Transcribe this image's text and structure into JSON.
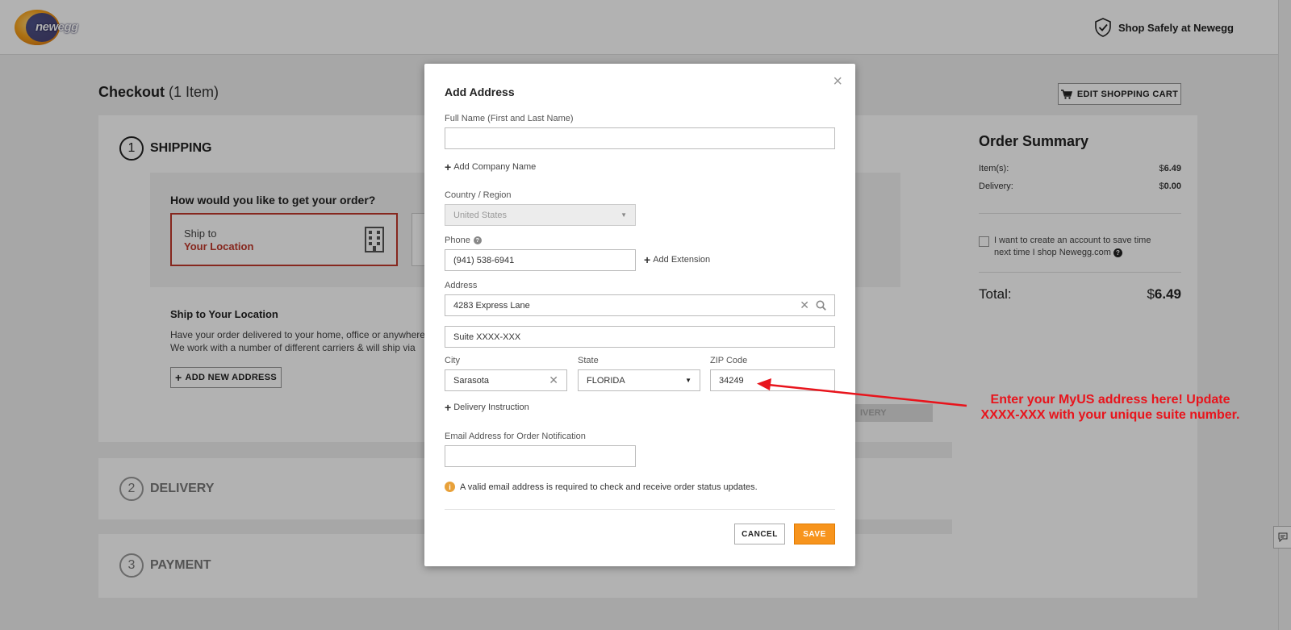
{
  "header": {
    "logo_text": "newegg",
    "shop_safely": "Shop Safely at Newegg"
  },
  "checkout": {
    "title": "Checkout",
    "item_count": "(1 Item)",
    "edit_cart": "EDIT SHOPPING CART",
    "steps": [
      {
        "num": "1",
        "label": "SHIPPING"
      },
      {
        "num": "2",
        "label": "DELIVERY"
      },
      {
        "num": "3",
        "label": "PAYMENT"
      }
    ],
    "question": "How would you like to get your order?",
    "ship_to_line1": "Ship to",
    "ship_to_line2": "Your Location",
    "ship_loc_title": "Ship to Your Location",
    "ship_loc_desc1": "Have your order delivered to your home, office or anywhere",
    "ship_loc_desc2": "We work with a number of different carriers & will ship via",
    "add_new_address": "ADD NEW ADDRESS",
    "ghost_button": "IVERY"
  },
  "summary": {
    "title": "Order Summary",
    "items_label": "Item(s):",
    "items_currency": "$",
    "items_value": "6.49",
    "delivery_label": "Delivery:",
    "delivery_currency": "$",
    "delivery_value": "0.00",
    "account_text_1": "I want to create an account to save time",
    "account_text_2": "next time I shop Newegg.com",
    "total_label": "Total:",
    "total_currency": "$",
    "total_value": "6.49"
  },
  "modal": {
    "title": "Add Address",
    "close": "×",
    "full_name_label": "Full Name (First and Last Name)",
    "full_name_value": "",
    "add_company": "Add Company Name",
    "country_label": "Country / Region",
    "country_value": "United States",
    "phone_label": "Phone",
    "phone_value": "(941) 538-6941",
    "add_extension": "Add Extension",
    "address_label": "Address",
    "address_value": "4283 Express Lane",
    "address2_value": "Suite XXXX-XXX",
    "city_label": "City",
    "city_value": "Sarasota",
    "state_label": "State",
    "state_value": "FLORIDA",
    "zip_label": "ZIP Code",
    "zip_value": "34249",
    "delivery_instruction": "Delivery Instruction",
    "email_label": "Email Address for Order Notification",
    "email_value": "",
    "email_info": "A valid email address is required to check and receive order status updates.",
    "cancel": "CANCEL",
    "save": "SAVE"
  },
  "annotation": {
    "line1": "Enter your MyUS address here! Update",
    "line2": "XXXX-XXX with your unique suite number.",
    "color": "#e8141c"
  },
  "colors": {
    "accent": "#f7941d",
    "brand_red": "#c0392b"
  }
}
